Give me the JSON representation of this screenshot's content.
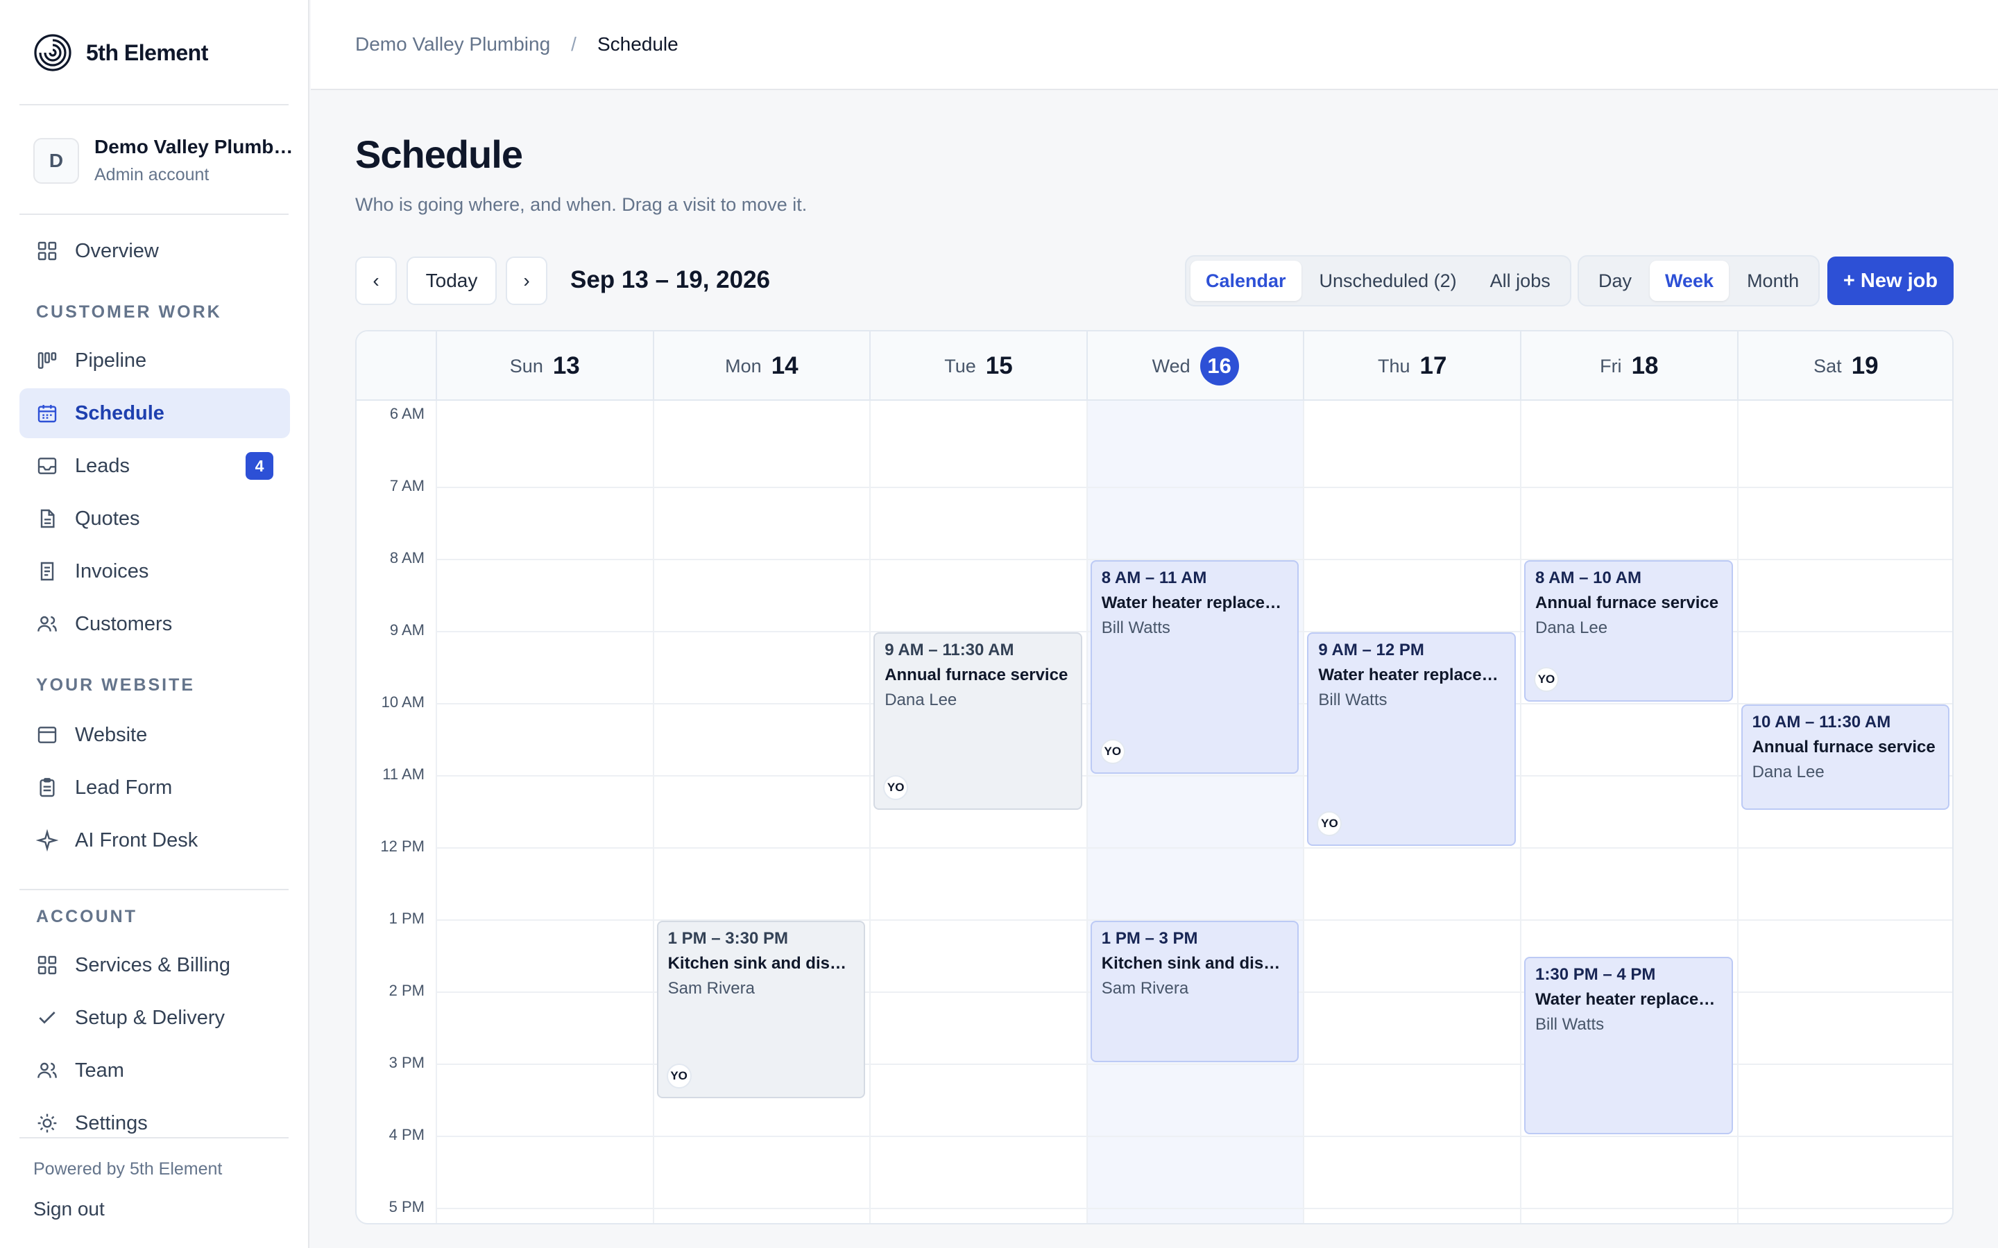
{
  "brand": {
    "name": "5th Element"
  },
  "account": {
    "initial": "D",
    "name": "Demo Valley Plumbing",
    "role": "Admin account"
  },
  "nav": {
    "overview": "Overview",
    "section_customer": "CUSTOMER WORK",
    "pipeline": "Pipeline",
    "schedule": "Schedule",
    "leads": "Leads",
    "leads_badge": "4",
    "quotes": "Quotes",
    "invoices": "Invoices",
    "customers": "Customers",
    "section_website": "YOUR WEBSITE",
    "website": "Website",
    "lead_form": "Lead Form",
    "ai_front_desk": "AI Front Desk",
    "section_account": "ACCOUNT",
    "services_billing": "Services & Billing",
    "setup_delivery": "Setup & Delivery",
    "team": "Team",
    "settings": "Settings"
  },
  "footer": {
    "powered": "Powered by 5th Element",
    "sign_out": "Sign out"
  },
  "breadcrumb": {
    "parent": "Demo Valley Plumbing",
    "separator": "/",
    "current": "Schedule"
  },
  "page": {
    "title": "Schedule",
    "subtitle": "Who is going where, and when. Drag a visit to move it."
  },
  "toolbar": {
    "prev": "‹",
    "today": "Today",
    "next": "›",
    "range": "Sep 13 – 19, 2026",
    "views": [
      "Calendar",
      "Unscheduled (2)",
      "All jobs"
    ],
    "active_view": "Calendar",
    "scales": [
      "Day",
      "Week",
      "Month"
    ],
    "active_scale": "Week",
    "new_job": "+ New job"
  },
  "calendar": {
    "days": [
      {
        "name": "Sun",
        "num": "13"
      },
      {
        "name": "Mon",
        "num": "14"
      },
      {
        "name": "Tue",
        "num": "15"
      },
      {
        "name": "Wed",
        "num": "16",
        "today": true
      },
      {
        "name": "Thu",
        "num": "17"
      },
      {
        "name": "Fri",
        "num": "18"
      },
      {
        "name": "Sat",
        "num": "19"
      }
    ],
    "hours": [
      "6 AM",
      "7 AM",
      "8 AM",
      "9 AM",
      "10 AM",
      "11 AM",
      "12 PM",
      "1 PM",
      "2 PM",
      "3 PM",
      "4 PM",
      "5 PM"
    ],
    "events": [
      {
        "day": 1,
        "start": 13,
        "end": 15.5,
        "time": "1 PM – 3:30 PM",
        "title": "Kitchen sink and disposal",
        "person": "Sam Rivera",
        "assignee": "YO",
        "style": "gray"
      },
      {
        "day": 2,
        "start": 9,
        "end": 11.5,
        "time": "9 AM – 11:30 AM",
        "title": "Annual furnace service",
        "person": "Dana Lee",
        "assignee": "YO",
        "style": "gray"
      },
      {
        "day": 3,
        "start": 8,
        "end": 11,
        "time": "8 AM – 11 AM",
        "title": "Water heater replacement",
        "person": "Bill Watts",
        "assignee": "YO",
        "style": "blue"
      },
      {
        "day": 3,
        "start": 13,
        "end": 15,
        "time": "1 PM – 3 PM",
        "title": "Kitchen sink and disposal",
        "person": "Sam Rivera",
        "assignee": "",
        "style": "blue"
      },
      {
        "day": 4,
        "start": 9,
        "end": 12,
        "time": "9 AM – 12 PM",
        "title": "Water heater replacement",
        "person": "Bill Watts",
        "assignee": "YO",
        "style": "blue"
      },
      {
        "day": 5,
        "start": 8,
        "end": 10,
        "time": "8 AM – 10 AM",
        "title": "Annual furnace service",
        "person": "Dana Lee",
        "assignee": "YO",
        "style": "blue"
      },
      {
        "day": 5,
        "start": 13.5,
        "end": 16,
        "time": "1:30 PM – 4 PM",
        "title": "Water heater replacement",
        "person": "Bill Watts",
        "assignee": "",
        "style": "blue"
      },
      {
        "day": 6,
        "start": 10,
        "end": 11.5,
        "time": "10 AM – 11:30 AM",
        "title": "Annual furnace service",
        "person": "Dana Lee",
        "assignee": "",
        "style": "blue"
      }
    ]
  },
  "colors": {
    "accent": "#2d50d6",
    "active_nav_bg": "#e6ecfb",
    "event_blue": "#e4e9fb",
    "event_gray": "#eef1f5",
    "today_column": "#f3f6fd"
  }
}
